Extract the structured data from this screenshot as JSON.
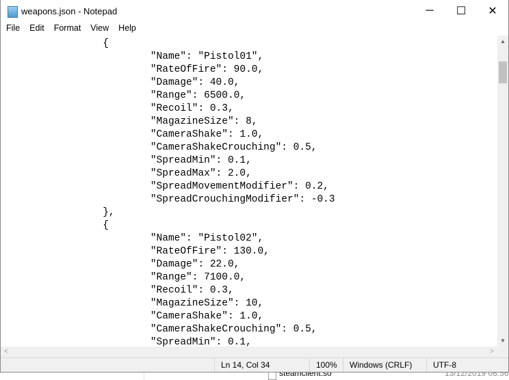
{
  "window": {
    "title": "weapons.json - Notepad",
    "icon": "notepad-icon"
  },
  "controls": {
    "minimize": "─",
    "maximize": "☐",
    "close": "✕"
  },
  "menu": [
    "File",
    "Edit",
    "Format",
    "View",
    "Help"
  ],
  "editor": {
    "content": "\t\t{\n\t\t\t\"Name\": \"Pistol01\",\n\t\t\t\"RateOfFire\": 90.0,\n\t\t\t\"Damage\": 40.0,\n\t\t\t\"Range\": 6500.0,\n\t\t\t\"Recoil\": 0.3,\n\t\t\t\"MagazineSize\": 8,\n\t\t\t\"CameraShake\": 1.0,\n\t\t\t\"CameraShakeCrouching\": 0.5,\n\t\t\t\"SpreadMin\": 0.1,\n\t\t\t\"SpreadMax\": 2.0,\n\t\t\t\"SpreadMovementModifier\": 0.2,\n\t\t\t\"SpreadCrouchingModifier\": -0.3\n\t\t},\n\t\t{\n\t\t\t\"Name\": \"Pistol02\",\n\t\t\t\"RateOfFire\": 130.0,\n\t\t\t\"Damage\": 22.0,\n\t\t\t\"Range\": 7100.0,\n\t\t\t\"Recoil\": 0.3,\n\t\t\t\"MagazineSize\": 10,\n\t\t\t\"CameraShake\": 1.0,\n\t\t\t\"CameraShakeCrouching\": 0.5,\n\t\t\t\"SpreadMin\": 0.1,"
  },
  "status": {
    "position": "Ln 14, Col 34",
    "zoom": "100%",
    "line_ending": "Windows (CRLF)",
    "encoding": "UTF-8"
  },
  "background": {
    "file_name": "steamclient.so",
    "file_date": "13/12/2019 08:56"
  }
}
